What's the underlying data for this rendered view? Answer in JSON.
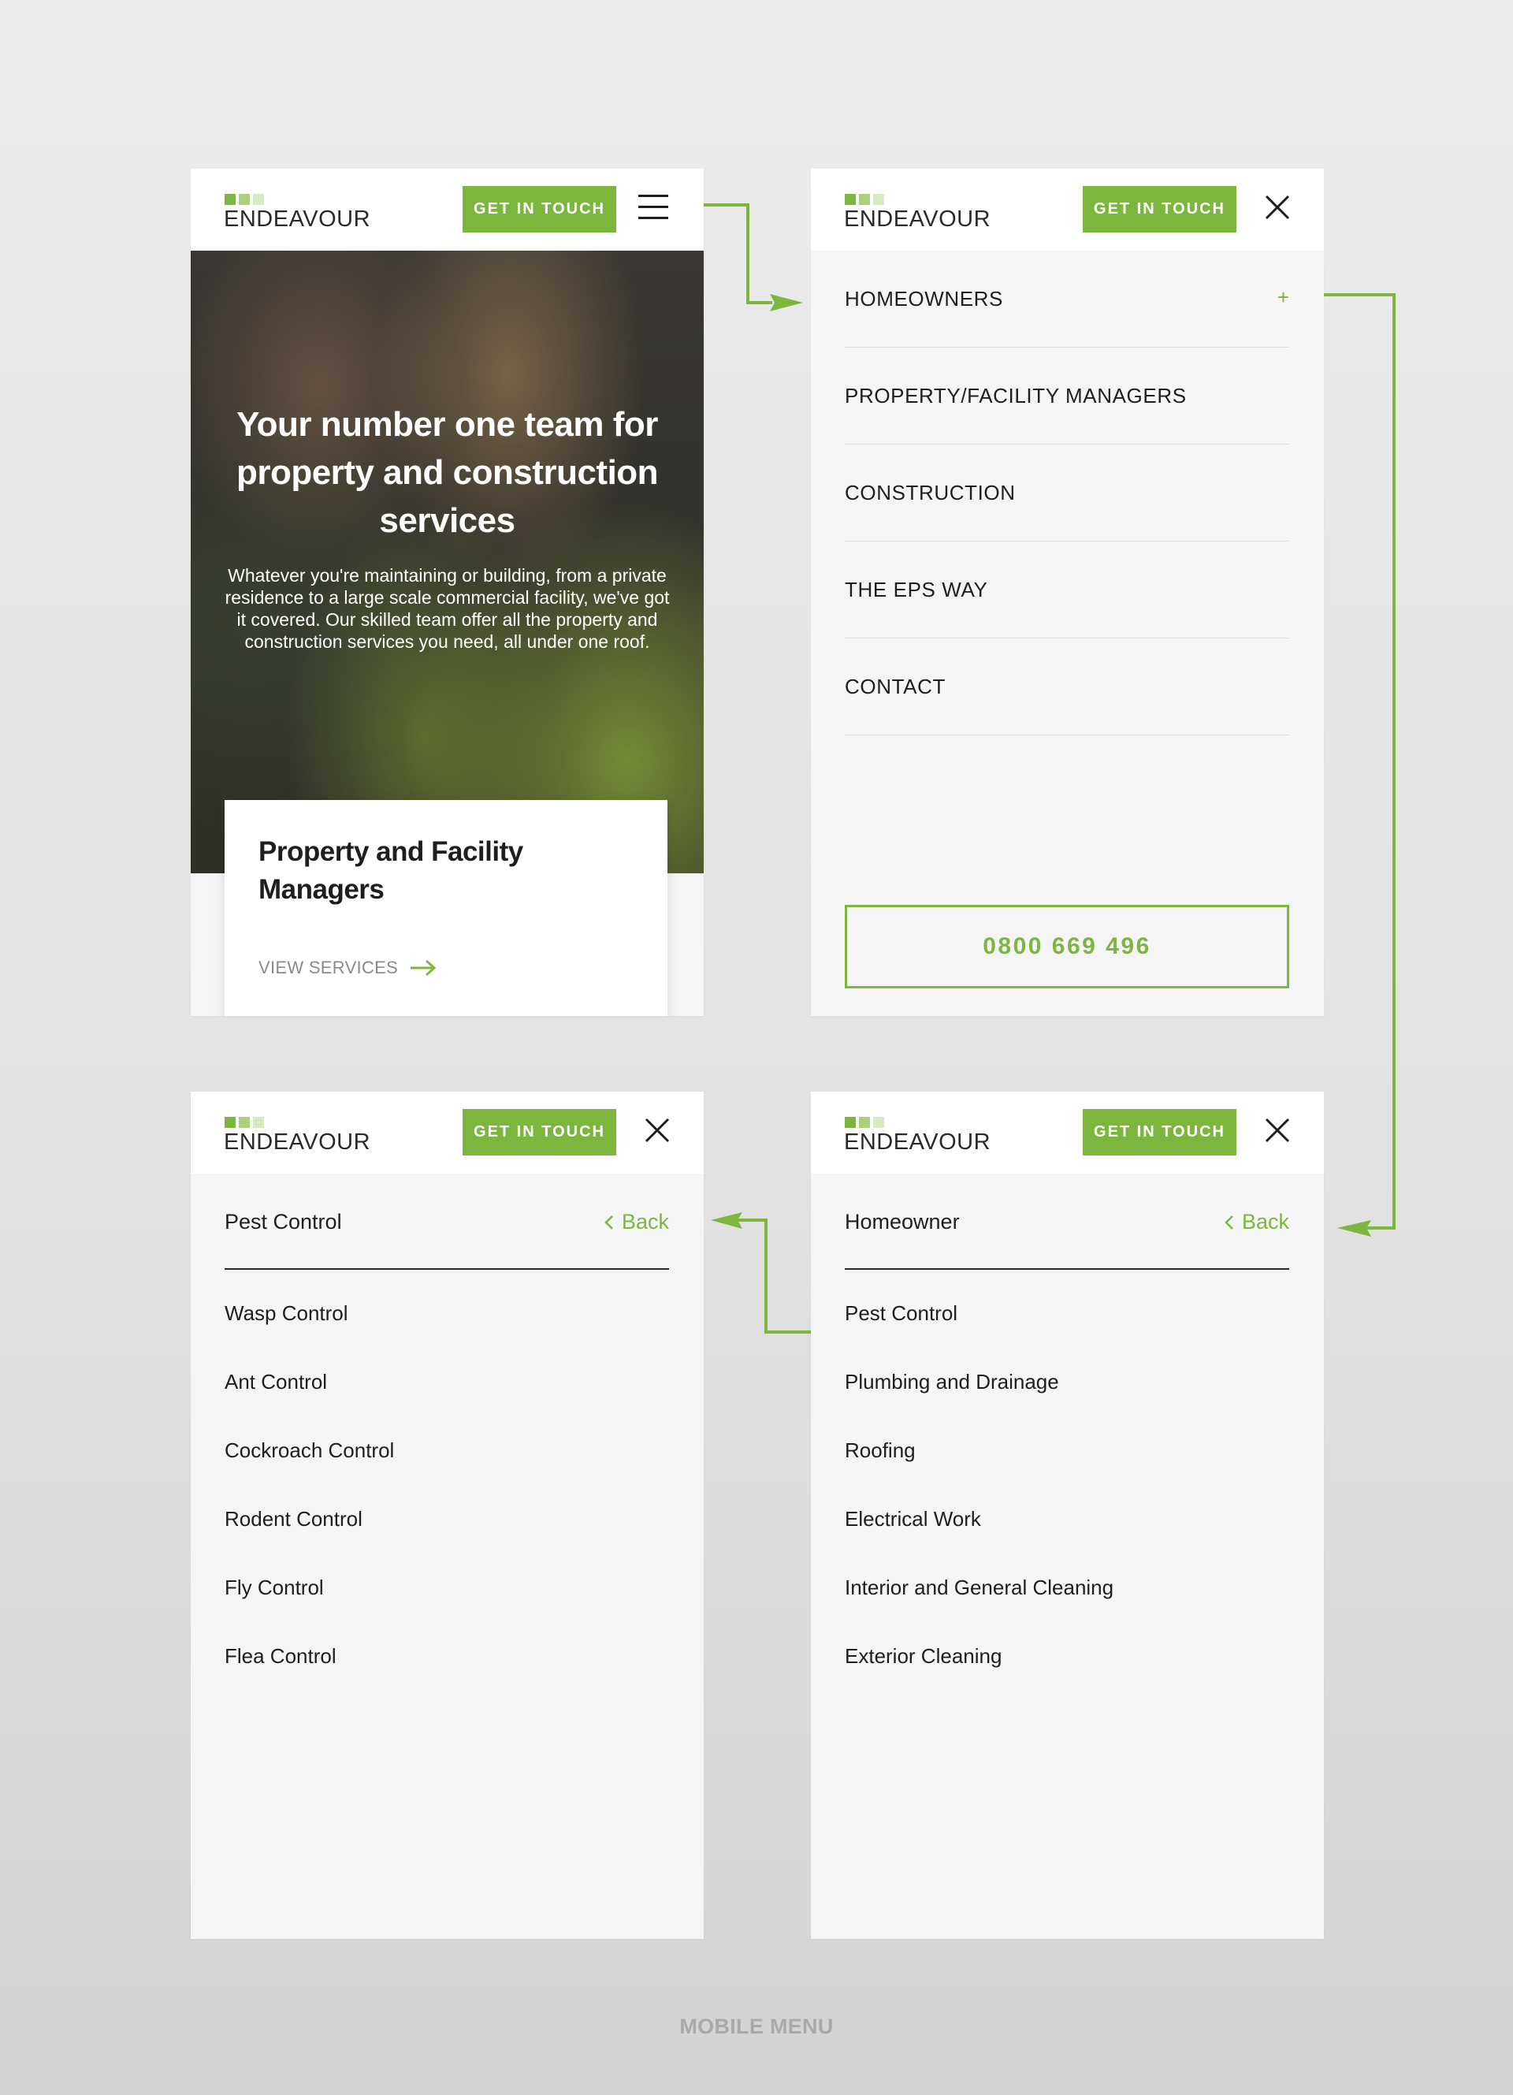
{
  "brand": {
    "logo_text": "ENDEAVOUR",
    "cta_label": "GET IN TOUCH",
    "accent_color": "#7cb63f"
  },
  "hero_screen": {
    "title": "Your number one team for property and construction services",
    "body": "Whatever you're maintaining or building, from a private residence to a large scale commercial facility, we've got it covered. Our skilled team offer all the property and construction services you need, all under one roof.",
    "card_title": "Property and Facility Managers",
    "card_link": "VIEW SERVICES",
    "menu_icon": "hamburger-menu-icon"
  },
  "main_menu_screen": {
    "items": [
      {
        "label": "HOMEOWNERS",
        "expand": "+"
      },
      {
        "label": "PROPERTY/FACILITY MANAGERS",
        "expand": ""
      },
      {
        "label": "CONSTRUCTION",
        "expand": ""
      },
      {
        "label": "THE EPS WAY",
        "expand": ""
      },
      {
        "label": "CONTACT",
        "expand": ""
      }
    ],
    "phone": "0800 669 496",
    "close_icon": "close-icon"
  },
  "homeowner_screen": {
    "title": "Homeowner",
    "back_label": "Back",
    "items": [
      "Pest Control",
      "Plumbing and Drainage",
      "Roofing",
      "Electrical Work",
      "Interior and General Cleaning",
      "Exterior Cleaning"
    ]
  },
  "pest_control_screen": {
    "title": "Pest Control",
    "back_label": "Back",
    "items": [
      "Wasp Control",
      "Ant Control",
      "Cockroach Control",
      "Rodent Control",
      "Fly Control",
      "Flea Control"
    ]
  },
  "caption": "MOBILE MENU"
}
